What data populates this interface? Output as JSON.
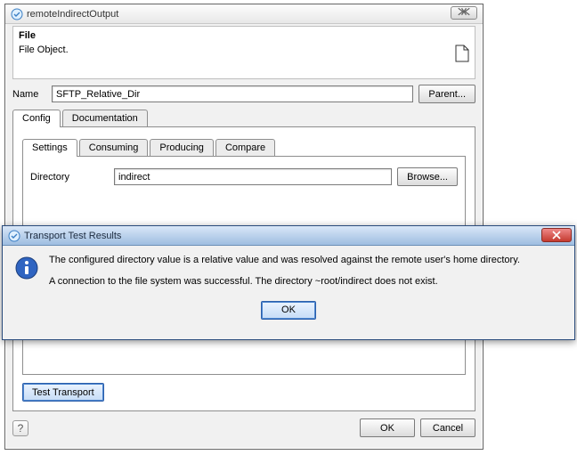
{
  "main": {
    "title": "remoteIndirectOutput",
    "close_glyph": "✕",
    "file_header": "File",
    "file_desc": "File Object.",
    "name_label": "Name",
    "name_value": "SFTP_Relative_Dir",
    "parent_button": "Parent...",
    "tabs": {
      "config": "Config",
      "documentation": "Documentation"
    },
    "inner_tabs": {
      "settings": "Settings",
      "consuming": "Consuming",
      "producing": "Producing",
      "compare": "Compare"
    },
    "directory_label": "Directory",
    "directory_value": "indirect",
    "browse_button": "Browse...",
    "test_transport_button": "Test Transport",
    "help_glyph": "?",
    "ok_button": "OK",
    "cancel_button": "Cancel"
  },
  "modal": {
    "title": "Transport Test Results",
    "line1": "The configured directory value is a relative value and was resolved against the remote user's home directory.",
    "line2": "A connection to the file system was successful. The directory ~root/indirect does not exist.",
    "ok_button": "OK"
  }
}
